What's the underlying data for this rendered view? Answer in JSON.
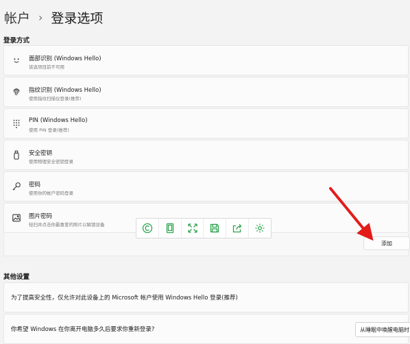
{
  "breadcrumb": {
    "parent": "帐户",
    "separator": "›",
    "current": "登录选项"
  },
  "sections": {
    "signin_methods": "登录方式",
    "other_settings": "其他设置"
  },
  "signin_options": [
    {
      "title": "面部识别 (Windows Hello)",
      "subtitle": "该选项目前不可用",
      "icon": "face-icon"
    },
    {
      "title": "指纹识别 (Windows Hello)",
      "subtitle": "使用指纹扫描仪登录(推荐)",
      "icon": "fingerprint-icon"
    },
    {
      "title": "PIN (Windows Hello)",
      "subtitle": "使用 PIN 登录(推荐)",
      "icon": "keypad-icon"
    },
    {
      "title": "安全密钥",
      "subtitle": "使用物理安全密钥登录",
      "icon": "usb-key-icon"
    },
    {
      "title": "密码",
      "subtitle": "使用你的帐户密码登录",
      "icon": "key-icon"
    },
    {
      "title": "图片密码",
      "subtitle": "轻扫并点击你最喜爱的照片以解锁设备",
      "icon": "picture-icon"
    }
  ],
  "add_button": "添加",
  "other_settings": [
    {
      "text": "为了提高安全性，仅允许对此设备上的 Microsoft 帐户使用 Windows Hello 登录(推荐)"
    },
    {
      "text": "你希望 Windows 在你离开电脑多久后要求你重新登录?"
    }
  ],
  "dropdown_value": "从睡眠中唤醒电脑时",
  "toolbar_icons": [
    "copyright-icon",
    "tablet-icon",
    "expand-icon",
    "save-icon",
    "share-icon",
    "gear-icon"
  ],
  "colors": {
    "toolbar_icon": "#2ea44f",
    "annotation_arrow": "#e31b1b"
  }
}
